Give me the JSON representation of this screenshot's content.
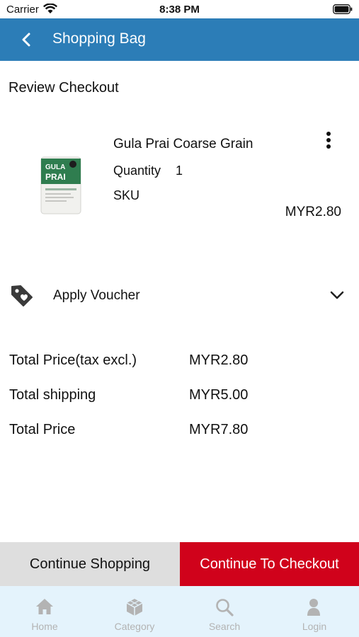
{
  "status_bar": {
    "carrier": "Carrier",
    "time": "8:38 PM"
  },
  "header": {
    "title": "Shopping Bag",
    "back_icon": "chevron-left-icon",
    "background": "#2c7db7"
  },
  "page": {
    "section_title": "Review Checkout"
  },
  "product": {
    "name": "Gula Prai Coarse Grain",
    "quantity_label": "Quantity",
    "quantity": "1",
    "sku_label": "SKU",
    "price": "MYR2.80",
    "menu_icon": "more-vertical-icon",
    "package_text": {
      "line1": "GULA",
      "line2": "PRAI"
    }
  },
  "voucher": {
    "label": "Apply Voucher",
    "icon": "tag-icon",
    "toggle_icon": "chevron-down-icon"
  },
  "summary": {
    "rows": [
      {
        "label": "Total Price(tax excl.)",
        "value": "MYR2.80"
      },
      {
        "label": "Total shipping",
        "value": "MYR5.00"
      },
      {
        "label": "Total Price",
        "value": "MYR7.80"
      }
    ]
  },
  "actions": {
    "continue_shopping": "Continue Shopping",
    "checkout": "Continue To Checkout",
    "checkout_color": "#d0021b"
  },
  "tabbar": {
    "tabs": [
      {
        "label": "Home",
        "icon": "home-icon"
      },
      {
        "label": "Category",
        "icon": "cube-icon"
      },
      {
        "label": "Search",
        "icon": "search-icon"
      },
      {
        "label": "Login",
        "icon": "user-icon"
      }
    ]
  }
}
